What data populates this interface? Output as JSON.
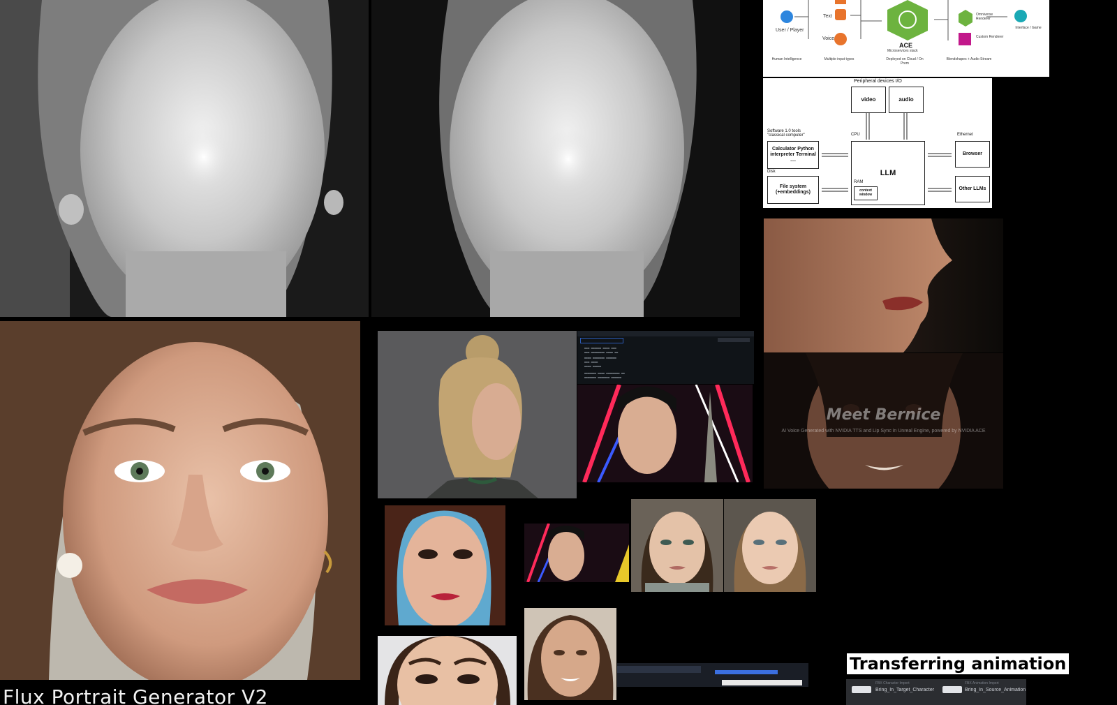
{
  "captions": {
    "portrait_generator": "Flux Portrait Generator V2",
    "transferring_animation": "Transferring animation"
  },
  "bernice": {
    "title": "Meet Bernice",
    "subtitle": "AI Voice Generated with NVIDIA TTS and Lip Sync in Unreal Engine, powered by NVIDIA ACE"
  },
  "ace_diagram": {
    "user_label": "User / Player",
    "human_intelligence": "Human Intelligence",
    "multi_input": "Multiple input types",
    "text_label": "Text",
    "voice_label": "Voice",
    "ace_label": "ACE",
    "microservices": "Microservices stack",
    "deployed": "Deployed on Cloud / On Prem",
    "omniverse": "Omniverse Renderer",
    "custom": "Custom Renderer",
    "interface": "Interface / Game",
    "blendshapes": "Blendshapes + Audio Stream"
  },
  "llm_diagram": {
    "peripheral": "Peripheral devices I/O",
    "video": "video",
    "audio": "audio",
    "software_tools": "Software 1.0 tools \"classical computer\"",
    "cpu": "CPU",
    "ethernet": "Ethernet",
    "calculator": "Calculator Python interpreter Terminal ....",
    "llm": "LLM",
    "browser": "Browser",
    "disk": "Disk",
    "ram": "RAM",
    "filesystem": "File system (+embeddings)",
    "context_window": "context window",
    "other_llms": "Other LLMs"
  },
  "node_editor": {
    "target_node": "Bring_In_Target_Character",
    "source_node": "Bring_In_Source_Animation",
    "target_header": "FBX Character Import",
    "source_header": "FBX Animation Import"
  },
  "colors": {
    "background": "#000000",
    "ace_green": "#6db33f",
    "ace_blue": "#2e86de",
    "ace_orange": "#e8742c",
    "ace_magenta": "#c2188b",
    "ace_teal": "#1aa9b5"
  }
}
